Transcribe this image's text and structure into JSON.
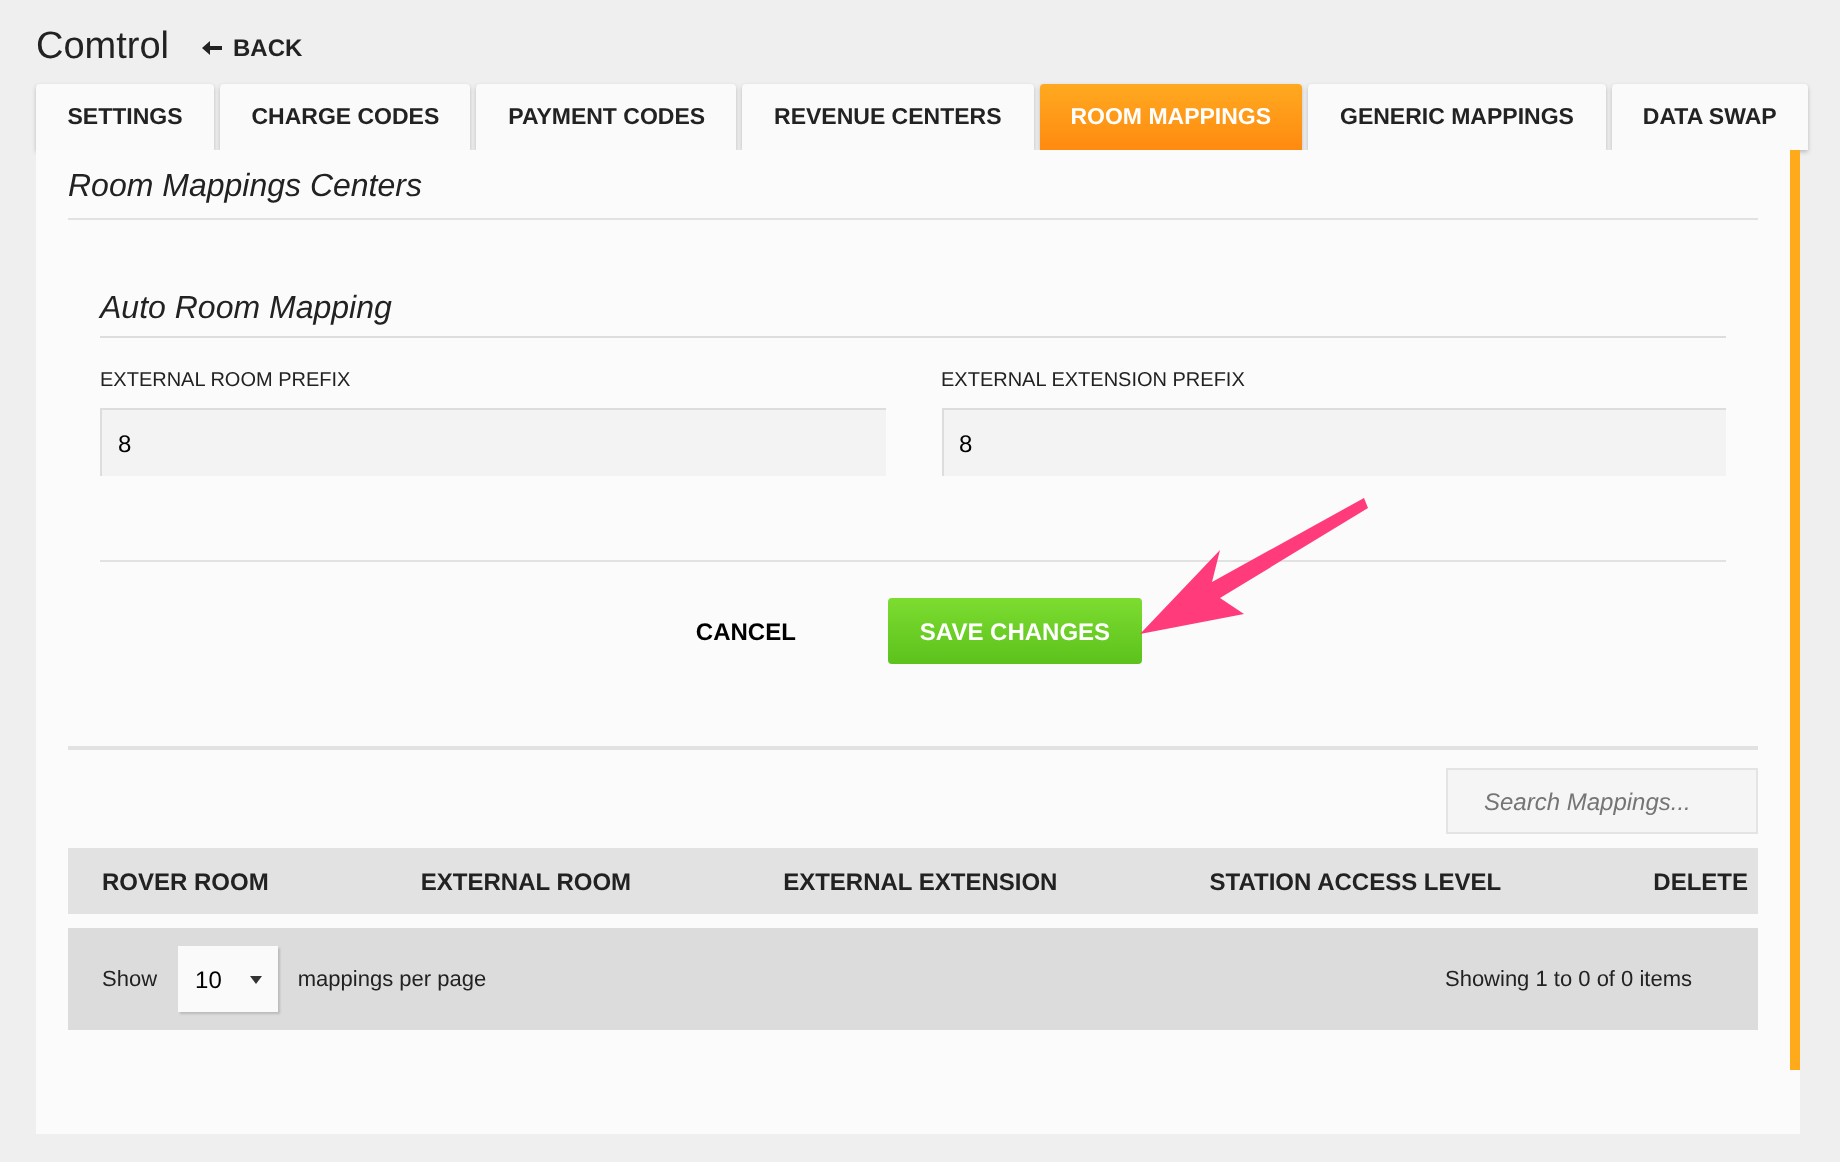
{
  "header": {
    "title": "Comtrol",
    "back": "BACK"
  },
  "tabs": [
    {
      "label": "SETTINGS",
      "selected": false
    },
    {
      "label": "CHARGE CODES",
      "selected": false
    },
    {
      "label": "PAYMENT CODES",
      "selected": false
    },
    {
      "label": "REVENUE CENTERS",
      "selected": false
    },
    {
      "label": "ROOM MAPPINGS",
      "selected": true
    },
    {
      "label": "GENERIC MAPPINGS",
      "selected": false
    },
    {
      "label": "DATA SWAP",
      "selected": false
    }
  ],
  "panel": {
    "title": "Room Mappings Centers"
  },
  "auto_mapping": {
    "title": "Auto Room Mapping",
    "fields": [
      {
        "label": "EXTERNAL ROOM PREFIX",
        "value": "8"
      },
      {
        "label": "EXTERNAL EXTENSION PREFIX",
        "value": "8"
      }
    ],
    "cancel": "CANCEL",
    "save": "SAVE CHANGES"
  },
  "search": {
    "placeholder": "Search Mappings..."
  },
  "table": {
    "columns": [
      "ROVER ROOM",
      "EXTERNAL ROOM",
      "EXTERNAL EXTENSION",
      "STATION ACCESS LEVEL",
      "DELETE"
    ]
  },
  "pager": {
    "show": "Show",
    "page_size": "10",
    "per_page": "mappings per page",
    "summary": "Showing 1 to 0 of 0 items"
  }
}
